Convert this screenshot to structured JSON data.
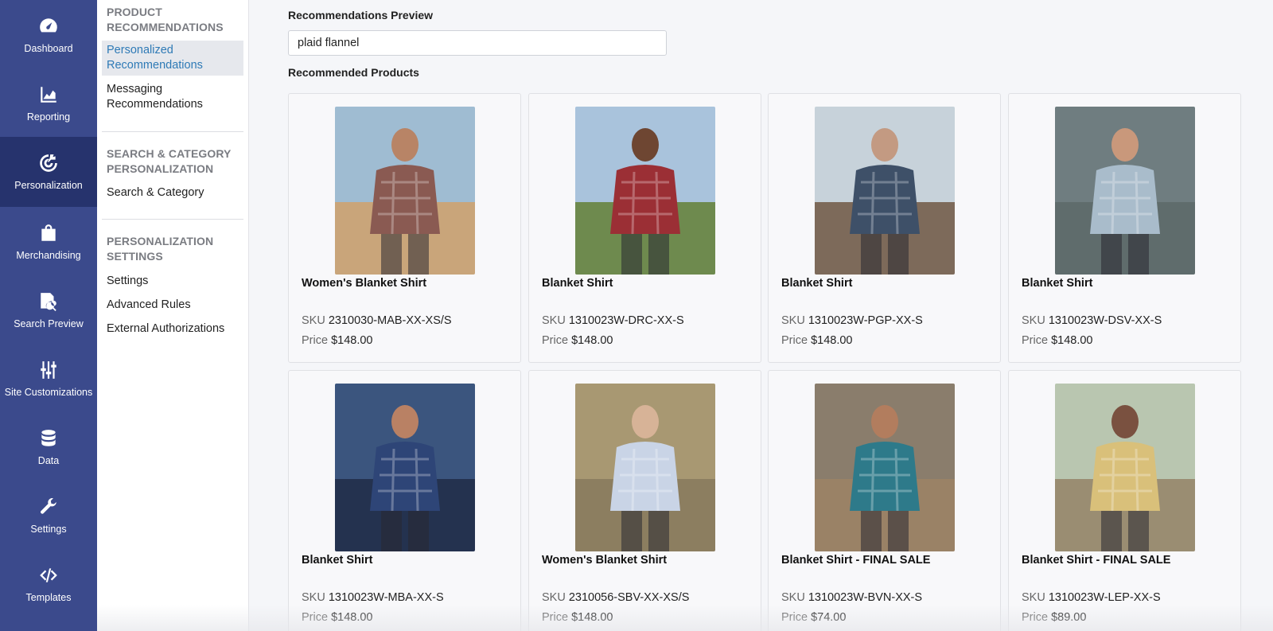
{
  "rail": {
    "items": [
      {
        "label": "Dashboard",
        "icon": "gauge-icon"
      },
      {
        "label": "Reporting",
        "icon": "chart-icon"
      },
      {
        "label": "Personalization",
        "icon": "target-icon",
        "active": true
      },
      {
        "label": "Merchandising",
        "icon": "shopping-bag-icon"
      },
      {
        "label": "Search Preview",
        "icon": "document-search-icon"
      },
      {
        "label": "Site Customizations",
        "icon": "sliders-icon"
      },
      {
        "label": "Data",
        "icon": "database-icon"
      },
      {
        "label": "Settings",
        "icon": "wrench-icon"
      },
      {
        "label": "Templates",
        "icon": "code-icon"
      }
    ]
  },
  "subnav": {
    "sections": [
      {
        "title": "PRODUCT RECOMMENDATIONS",
        "links": [
          "Personalized Recommendations",
          "Messaging Recommendations"
        ]
      },
      {
        "title": "SEARCH & CATEGORY PERSONALIZATION",
        "links": [
          "Search & Category"
        ]
      },
      {
        "title": "PERSONALIZATION SETTINGS",
        "links": [
          "Settings",
          "Advanced Rules",
          "External Authorizations"
        ]
      }
    ],
    "active_link": "Personalized Recommendations"
  },
  "main": {
    "preview_title": "Recommendations Preview",
    "search_value": "plaid flannel",
    "products_title": "Recommended Products",
    "sku_label": "SKU",
    "price_label": "Price",
    "products": [
      {
        "name": "Women's Blanket Shirt",
        "sku": "2310030-MAB-XX-XS/S",
        "price": "$148.00",
        "colors": {
          "sky": "#9fbcd2",
          "ground": "#c9a57a",
          "shirt": "#8a5a52",
          "skin": "#b88466"
        }
      },
      {
        "name": "Blanket Shirt",
        "sku": "1310023W-DRC-XX-S",
        "price": "$148.00",
        "colors": {
          "sky": "#a9c3dc",
          "ground": "#6e8a4e",
          "shirt": "#9b2f35",
          "skin": "#6e4632"
        }
      },
      {
        "name": "Blanket Shirt",
        "sku": "1310023W-PGP-XX-S",
        "price": "$148.00",
        "colors": {
          "sky": "#c7d2da",
          "ground": "#7d6a5a",
          "shirt": "#3e5068",
          "skin": "#c39a82"
        }
      },
      {
        "name": "Blanket Shirt",
        "sku": "1310023W-DSV-XX-S",
        "price": "$148.00",
        "colors": {
          "sky": "#6f7d80",
          "ground": "#5f6c6c",
          "shirt": "#a9bccb",
          "skin": "#c9987b"
        }
      },
      {
        "name": "Blanket Shirt",
        "sku": "1310023W-MBA-XX-S",
        "price": "$148.00",
        "colors": {
          "sky": "#3b557e",
          "ground": "#24324f",
          "shirt": "#2e4577",
          "skin": "#b98164"
        }
      },
      {
        "name": "Women's Blanket Shirt",
        "sku": "2310056-SBV-XX-XS/S",
        "price": "$148.00",
        "colors": {
          "sky": "#a89872",
          "ground": "#8c7e60",
          "shirt": "#c9d4e6",
          "skin": "#d7b397"
        }
      },
      {
        "name": "Blanket Shirt - FINAL SALE",
        "sku": "1310023W-BVN-XX-S",
        "price": "$74.00",
        "colors": {
          "sky": "#8a7d6c",
          "ground": "#9a8266",
          "shirt": "#2e7a8a",
          "skin": "#b27d5e"
        }
      },
      {
        "name": "Blanket Shirt - FINAL SALE",
        "sku": "1310023W-LEP-XX-S",
        "price": "$89.00",
        "colors": {
          "sky": "#b9c6b0",
          "ground": "#9a8d72",
          "shirt": "#d9c07a",
          "skin": "#7a5140"
        }
      }
    ]
  },
  "theme": {
    "rail_bg": "#3b4a8c",
    "rail_active": "#26336d",
    "link_active": "#2e7ab6"
  }
}
